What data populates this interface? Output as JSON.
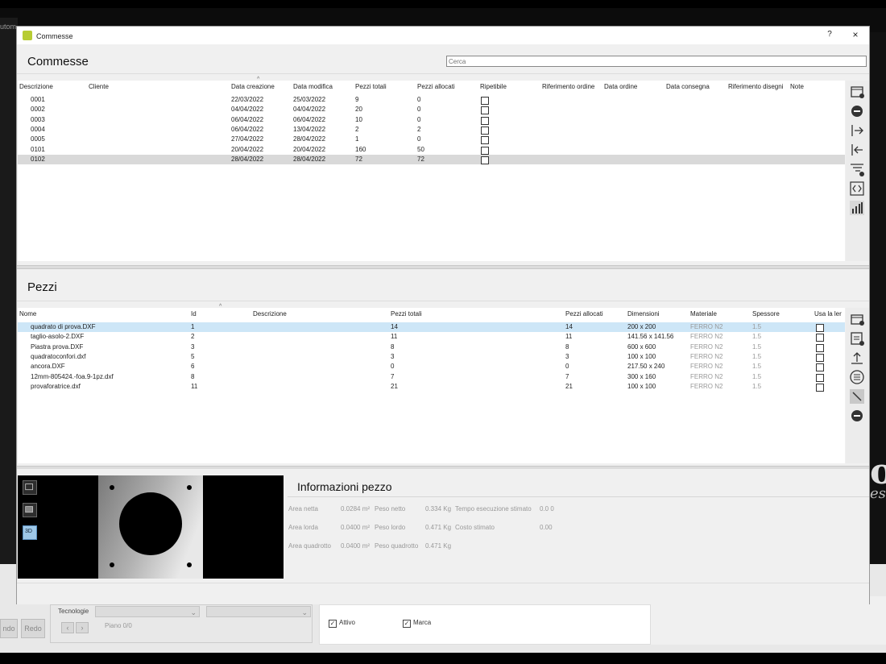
{
  "background": {
    "menu_word": "utom",
    "logo_o": "o",
    "logo_es": "es",
    "undo_label": "ndo",
    "redo_label": "Redo",
    "tecnologia_label": "Tecnologie",
    "piano_label": "Piano 0/0",
    "attivo_label": "Attivo",
    "marca_label": "Marca",
    "nav_prev": "‹",
    "nav_next": "›"
  },
  "window": {
    "title": "Commesse",
    "help": "?",
    "close": "×"
  },
  "commesse": {
    "heading": "Commesse",
    "search_placeholder": "Cerca",
    "columns": [
      "Descrizione",
      "Cliente",
      "Data creazione",
      "Data modifica",
      "Pezzi totali",
      "Pezzi allocati",
      "Ripetibile",
      "Riferimento ordine",
      "Data ordine",
      "Data consegna",
      "Riferimento disegni",
      "Note"
    ],
    "rows": [
      {
        "desc": "0001",
        "cliente": "",
        "creazione": "22/03/2022",
        "modifica": "25/03/2022",
        "totali": "9",
        "allocati": "0",
        "selected": false
      },
      {
        "desc": "0002",
        "cliente": "",
        "creazione": "04/04/2022",
        "modifica": "04/04/2022",
        "totali": "20",
        "allocati": "0",
        "selected": false
      },
      {
        "desc": "0003",
        "cliente": "",
        "creazione": "06/04/2022",
        "modifica": "06/04/2022",
        "totali": "10",
        "allocati": "0",
        "selected": false
      },
      {
        "desc": "0004",
        "cliente": "",
        "creazione": "06/04/2022",
        "modifica": "13/04/2022",
        "totali": "2",
        "allocati": "2",
        "selected": false
      },
      {
        "desc": "0005",
        "cliente": "",
        "creazione": "27/04/2022",
        "modifica": "28/04/2022",
        "totali": "1",
        "allocati": "0",
        "selected": false
      },
      {
        "desc": "0101",
        "cliente": "",
        "creazione": "20/04/2022",
        "modifica": "20/04/2022",
        "totali": "160",
        "allocati": "50",
        "selected": false
      },
      {
        "desc": "0102",
        "cliente": "",
        "creazione": "28/04/2022",
        "modifica": "28/04/2022",
        "totali": "72",
        "allocati": "72",
        "selected": true
      }
    ],
    "side_icons": [
      "new-commessa-icon",
      "delete-commessa-icon",
      "export-icon",
      "import-icon",
      "filter-icon",
      "code-icon",
      "chart-icon"
    ]
  },
  "pezzi": {
    "heading": "Pezzi",
    "columns": [
      "Nome",
      "Id",
      "Descrizione",
      "Pezzi totali",
      "Pezzi allocati",
      "Dimensioni",
      "Materiale",
      "Spessore",
      "Usa la ler"
    ],
    "rows": [
      {
        "nome": "quadrato di prova.DXF",
        "id": "1",
        "descr": "",
        "totali": "14",
        "allocati": "14",
        "dim": "200 x 200",
        "mat": "FERRO N2",
        "spess": "1.5",
        "selected": true
      },
      {
        "nome": "taglio-asolo-2.DXF",
        "id": "2",
        "descr": "",
        "totali": "11",
        "allocati": "11",
        "dim": "141.56 x 141.56",
        "mat": "FERRO N2",
        "spess": "1.5",
        "selected": false
      },
      {
        "nome": "Piastra prova.DXF",
        "id": "3",
        "descr": "",
        "totali": "8",
        "allocati": "8",
        "dim": "600 x 600",
        "mat": "FERRO N2",
        "spess": "1.5",
        "selected": false
      },
      {
        "nome": "quadratoconfori.dxf",
        "id": "5",
        "descr": "",
        "totali": "3",
        "allocati": "3",
        "dim": "100 x 100",
        "mat": "FERRO N2",
        "spess": "1.5",
        "selected": false
      },
      {
        "nome": "ancora.DXF",
        "id": "6",
        "descr": "",
        "totali": "0",
        "allocati": "0",
        "dim": "217.50 x 240",
        "mat": "FERRO N2",
        "spess": "1.5",
        "selected": false
      },
      {
        "nome": "12mm-805424.-foa.9-1pz.dxf",
        "id": "8",
        "descr": "",
        "totali": "7",
        "allocati": "7",
        "dim": "300 x 160",
        "mat": "FERRO N2",
        "spess": "1.5",
        "selected": false
      },
      {
        "nome": "provaforatrice.dxf",
        "id": "11",
        "descr": "",
        "totali": "21",
        "allocati": "21",
        "dim": "100 x 100",
        "mat": "FERRO N2",
        "spess": "1.5",
        "selected": false
      }
    ],
    "side_icons": [
      "add-piece-icon",
      "edit-piece-icon",
      "upload-icon",
      "list-icon",
      "measure-icon",
      "remove-piece-icon"
    ]
  },
  "info": {
    "title": "Informazioni pezzo",
    "area_netta_label": "Area netta",
    "area_netta": "0.0284 m²",
    "peso_netto_label": "Peso netto",
    "peso_netto": "0.334 Kg",
    "tempo_label": "Tempo esecuzione stimato",
    "tempo": "0.0 0",
    "area_lorda_label": "Area lorda",
    "area_lorda": "0.0400 m²",
    "peso_lordo_label": "Peso lordo",
    "peso_lordo": "0.471 Kg",
    "costo_label": "Costo stimato",
    "costo": "0.00",
    "area_quadrotto_label": "Area quadrotto",
    "area_quadrotto": "0.0400 m²",
    "peso_quadrotto_label": "Peso quadrotto",
    "peso_quadrotto": "0.471 Kg",
    "view_3d": "3D"
  }
}
